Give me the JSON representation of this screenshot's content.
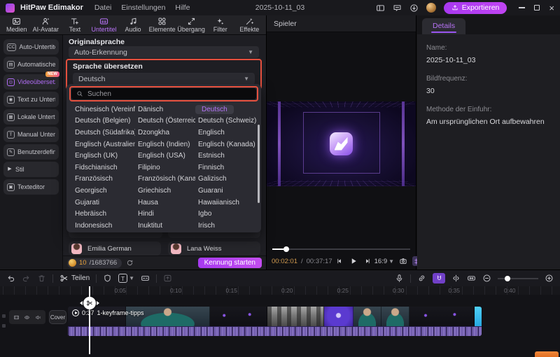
{
  "colors": {
    "accent_purple": "#a838f0",
    "selected_text": "#b06cf5",
    "highlight_red": "#e5503e",
    "time_current": "#cf9a4f",
    "credit_orange": "#e8a23c",
    "clip_cyan": "#35c3f0"
  },
  "titlebar": {
    "app": "HitPaw Edimakor",
    "menus": [
      {
        "label": "Datei"
      },
      {
        "label": "Einstellungen"
      },
      {
        "label": "Hilfe"
      }
    ],
    "project": "2025-10-11_03",
    "export_label": "Exportieren"
  },
  "ribbon": {
    "tabs": [
      {
        "label": "Medien"
      },
      {
        "label": "AI-Avatar"
      },
      {
        "label": "Text"
      },
      {
        "label": "Untertitel",
        "selected": true
      },
      {
        "label": "Audio"
      },
      {
        "label": "Elemente"
      },
      {
        "label": "Übergang"
      },
      {
        "label": "Filter"
      },
      {
        "label": "Effekte"
      }
    ]
  },
  "sidebar": {
    "items": [
      {
        "label": "Auto-Untertitel",
        "icon": "CC"
      },
      {
        "label": "Automatische ...",
        "icon": "▤"
      },
      {
        "label": "Videoübersetzer",
        "icon": "◎",
        "badge": "NEW",
        "selected": true
      },
      {
        "label": "Text zu Untert...",
        "icon": "◉"
      },
      {
        "label": "Lokale Unterti...",
        "icon": "▦"
      },
      {
        "label": "Manual Unter...",
        "icon": "T"
      },
      {
        "label": "Benutzerdefini...",
        "icon": "✎"
      },
      {
        "label": "Stil",
        "icon": "▶"
      },
      {
        "label": "Texteditor",
        "icon": "▣"
      }
    ]
  },
  "translator": {
    "source_label": "Originalsprache",
    "source_value": "Auto-Erkennung",
    "target_label": "Sprache übersetzen",
    "target_value": "Deutsch",
    "search_placeholder": "Suchen",
    "languages": [
      {
        "label": "Chinesisch (Vereinfa..."
      },
      {
        "label": "Dänisch"
      },
      {
        "label": "Deutsch",
        "selected": true
      },
      {
        "label": "Deutsch (Belgien)"
      },
      {
        "label": "Deutsch (Österreich)"
      },
      {
        "label": "Deutsch (Schweiz)"
      },
      {
        "label": "Deutsch (Südafrika)"
      },
      {
        "label": "Dzongkha"
      },
      {
        "label": "Englisch"
      },
      {
        "label": "Englisch (Australien)"
      },
      {
        "label": "Englisch (Indien)"
      },
      {
        "label": "Englisch (Kanada)"
      },
      {
        "label": "Englisch (UK)"
      },
      {
        "label": "Englisch (USA)"
      },
      {
        "label": "Estnisch"
      },
      {
        "label": "Fidschianisch"
      },
      {
        "label": "Filipino"
      },
      {
        "label": "Finnisch"
      },
      {
        "label": "Französisch"
      },
      {
        "label": "Französisch (Kanada)"
      },
      {
        "label": "Galizisch"
      },
      {
        "label": "Georgisch"
      },
      {
        "label": "Griechisch"
      },
      {
        "label": "Guarani"
      },
      {
        "label": "Gujarati"
      },
      {
        "label": "Hausa"
      },
      {
        "label": "Hawaiianisch"
      },
      {
        "label": "Hebräisch"
      },
      {
        "label": "Hindi"
      },
      {
        "label": "Igbo"
      },
      {
        "label": "Indonesisch"
      },
      {
        "label": "Inuktitut"
      },
      {
        "label": "Irisch"
      }
    ],
    "voices": [
      {
        "name": "Emilia German"
      },
      {
        "name": "Lana Weiss"
      }
    ],
    "credits_used": "10",
    "credits_total": "/1683766",
    "start_button": "Kennung starten"
  },
  "player": {
    "title": "Spieler",
    "current": "00:02:01",
    "sep": " / ",
    "duration": "00:37:17",
    "aspect": "16:9"
  },
  "details": {
    "tab": "Details",
    "fields": [
      {
        "label": "Name:",
        "value": "2025-10-11_03"
      },
      {
        "label": "Bildfrequenz:",
        "value": "30"
      },
      {
        "label": "Methode der Einfuhr:",
        "value": "Am ursprünglichen Ort aufbewahren"
      }
    ]
  },
  "timeline": {
    "split_label": "Teilen",
    "cover_label": "Cover",
    "clip": {
      "duration": "0:37",
      "name": "1-keyframe-tipps"
    },
    "ruler": [
      {
        "t": "0:05"
      },
      {
        "t": "0:10"
      },
      {
        "t": "0:15"
      },
      {
        "t": "0:20"
      },
      {
        "t": "0:25"
      },
      {
        "t": "0:30"
      },
      {
        "t": "0:35"
      },
      {
        "t": "0:40"
      }
    ]
  }
}
